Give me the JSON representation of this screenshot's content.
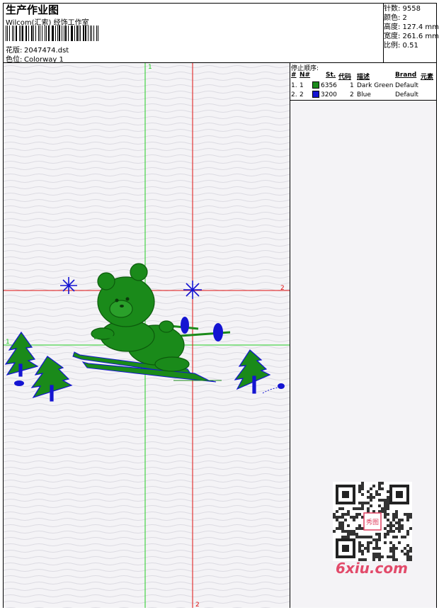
{
  "header": {
    "title": "生产作业图",
    "subtitle": "Wilcom(汇索) 经饰工作室",
    "pattern_label": "花版:",
    "pattern_value": "2047474.dst",
    "colorway_label": "色位:",
    "colorway_value": "Colorway 1"
  },
  "stats": {
    "stitches": "针数: 9558",
    "colors": "颜色: 2",
    "height": "高度: 127.4 mm",
    "width": "宽度: 261.6 mm",
    "scale": "比例: 0.51"
  },
  "stop_sequence": {
    "caption": "停止顺序:",
    "headers": [
      "#",
      "N#",
      "St.",
      "代码",
      "描述",
      "Brand",
      "元素"
    ],
    "rows": [
      {
        "num": "1.",
        "n": "1",
        "st": "6356",
        "code": "1",
        "desc": "Dark Green",
        "brand": "Default",
        "color": "#1a8a1a"
      },
      {
        "num": "2.",
        "n": "2",
        "st": "3200",
        "code": "2",
        "desc": "Blue",
        "brand": "Default",
        "color": "#1414d2"
      }
    ]
  },
  "guides": {
    "green_label": "1",
    "red_label": "2"
  },
  "watermark": {
    "logo_text": "6xiu.com",
    "stamp_text": "秀图"
  },
  "colors": {
    "green_guide": "#22cc22",
    "red_guide": "#e01010",
    "dark_green": "#1a8a1a",
    "blue": "#1414d2"
  }
}
